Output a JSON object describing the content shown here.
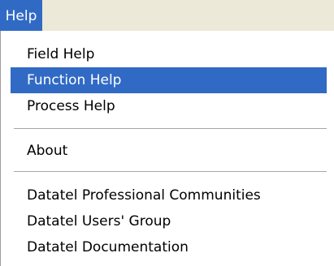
{
  "menubar": {
    "help_label": "Help"
  },
  "menu": {
    "items": [
      {
        "label": "Field Help"
      },
      {
        "label": "Function Help"
      },
      {
        "label": "Process Help"
      },
      {
        "label": "About"
      },
      {
        "label": "Datatel Professional Communities"
      },
      {
        "label": "Datatel Users' Group"
      },
      {
        "label": "Datatel Documentation"
      }
    ],
    "selected_item": "Function Help"
  },
  "colors": {
    "highlight": "#316ac5",
    "menubar_background": "#ece9d8",
    "separator": "#a7a6aa"
  }
}
